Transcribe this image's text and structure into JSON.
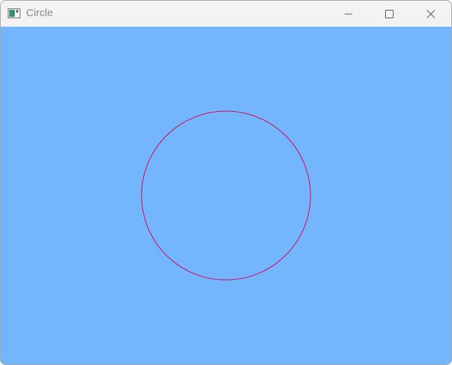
{
  "window": {
    "title": "Circle",
    "icons": {
      "app": "app-window-icon",
      "minimize": "minimize-icon",
      "maximize": "maximize-icon",
      "close": "close-icon"
    }
  },
  "scene": {
    "background_color": "#74b6fe",
    "circle_color": "#d6004c"
  }
}
